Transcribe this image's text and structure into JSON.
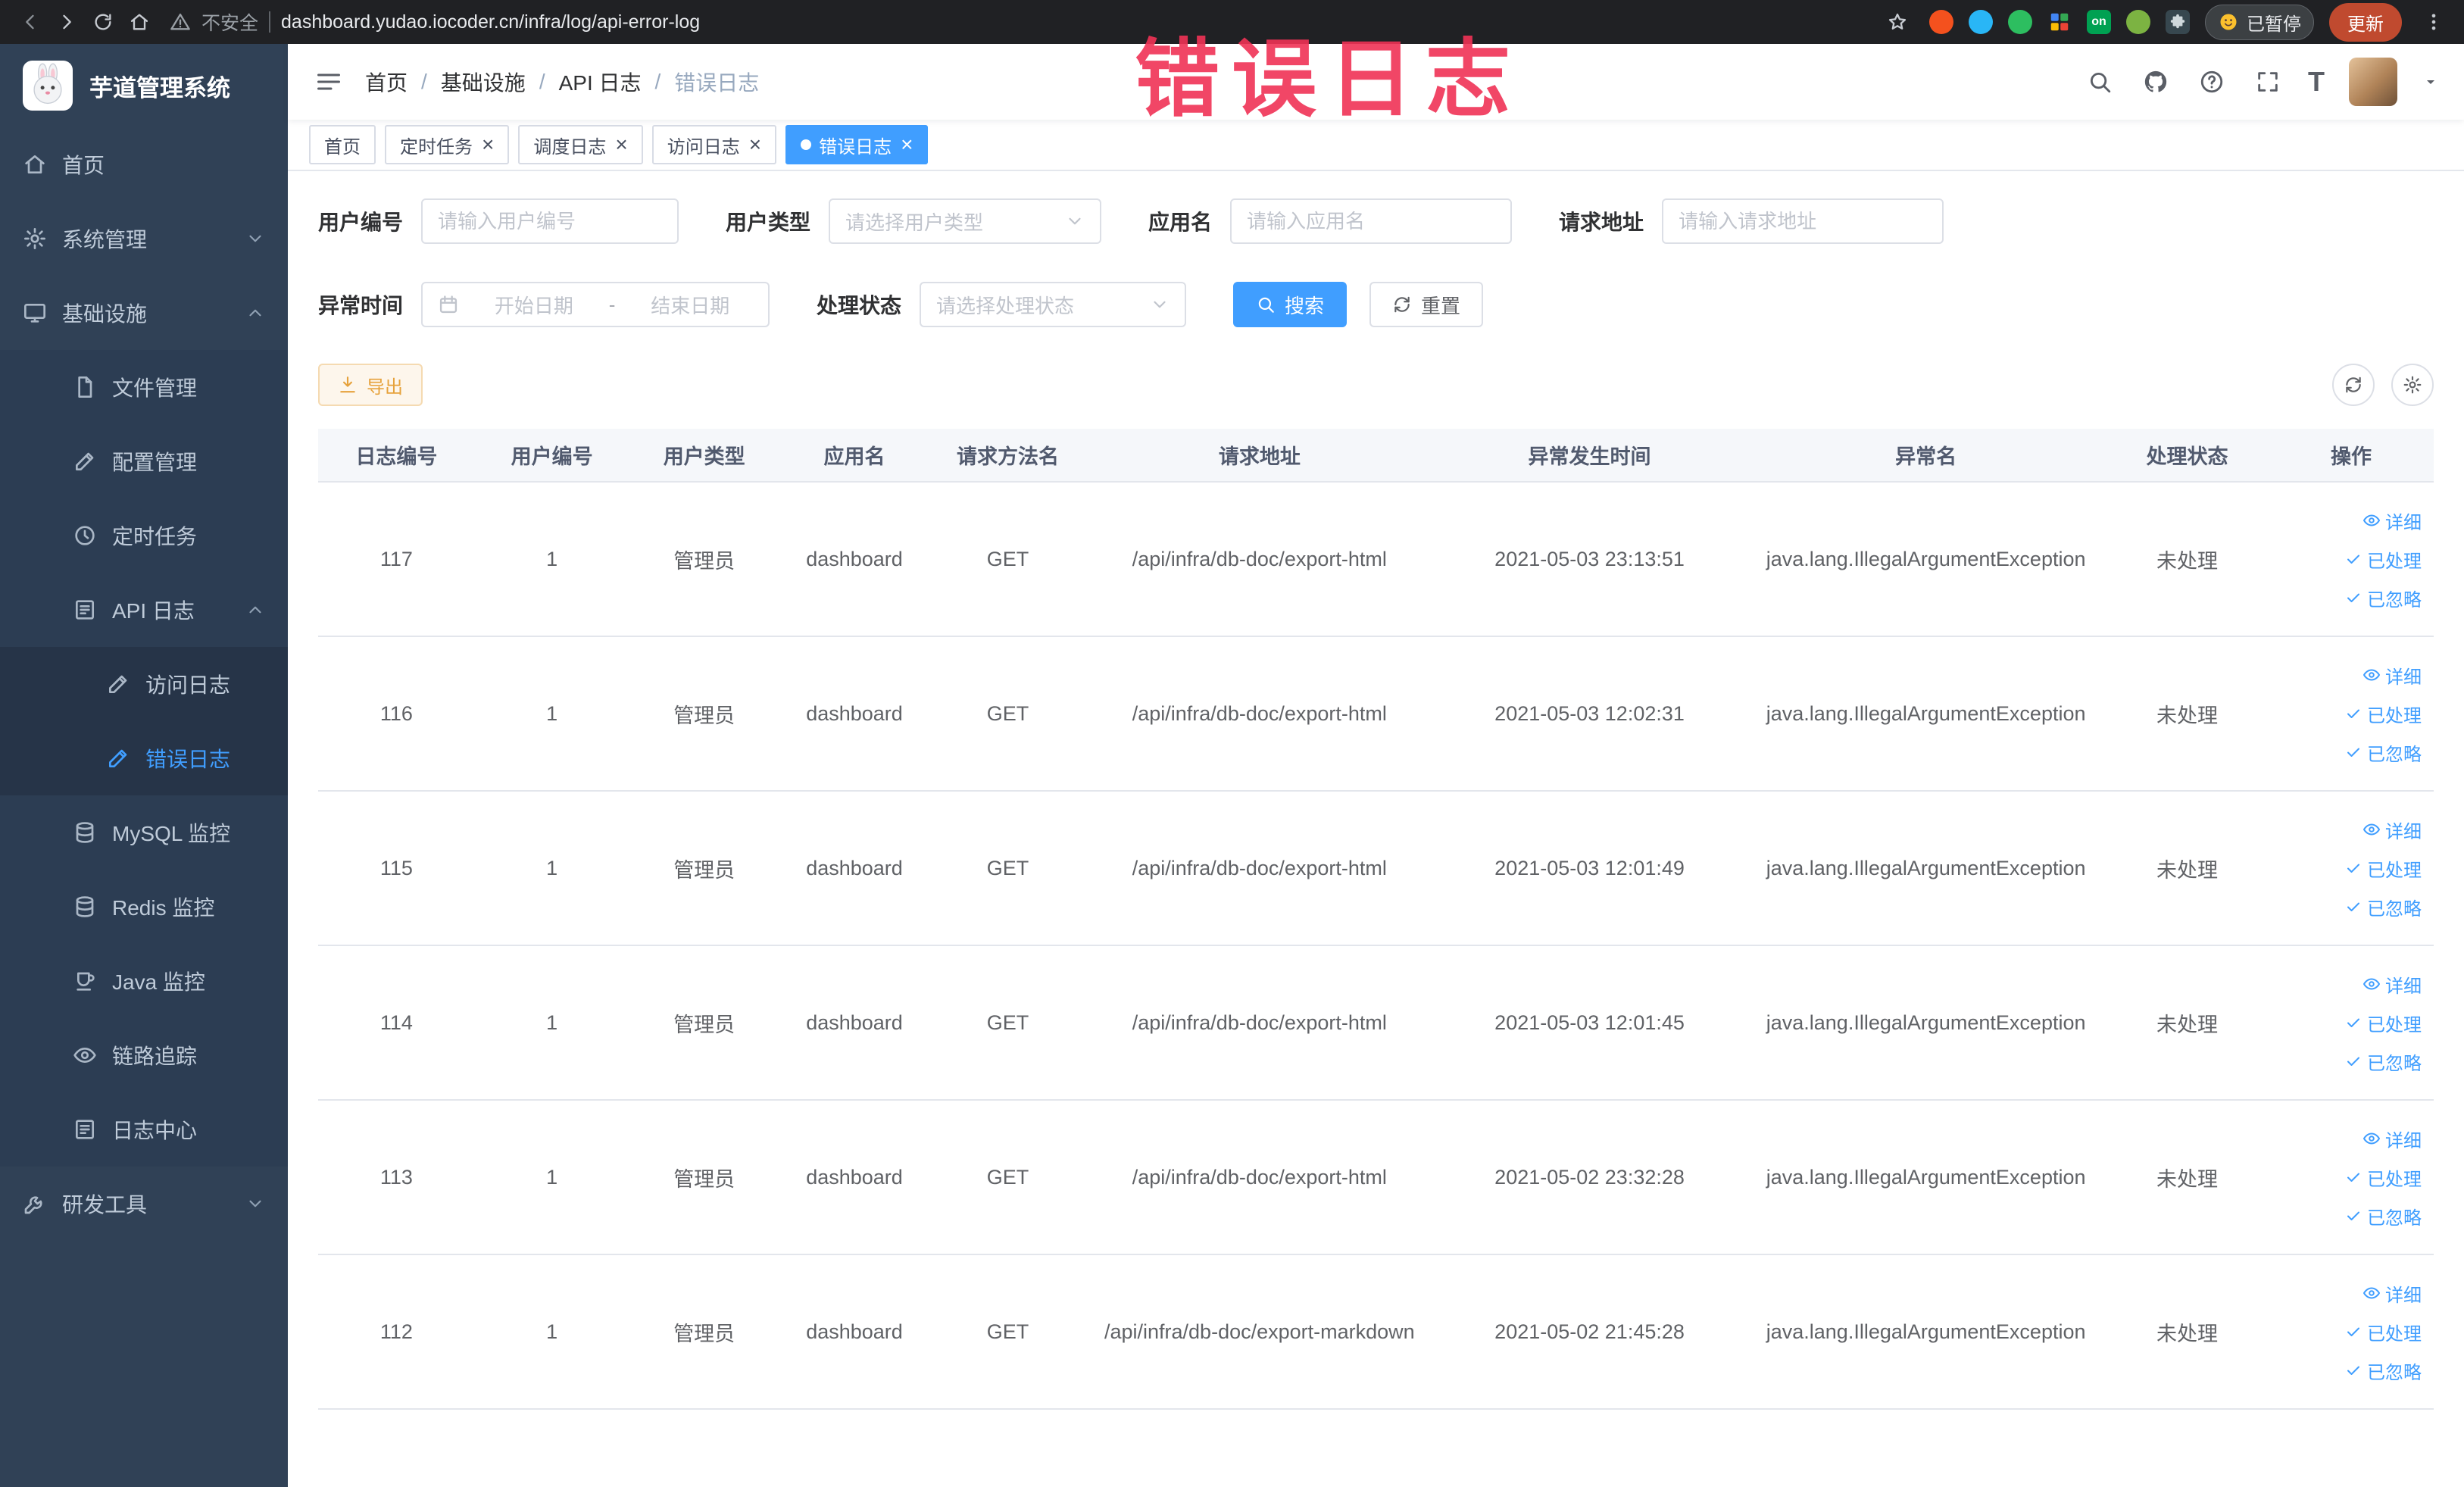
{
  "browser": {
    "security_label": "不安全",
    "url": "dashboard.yudao.iocoder.cn/infra/log/api-error-log",
    "paused_label": "已暂停",
    "update_label": "更新",
    "ext_on_label": "on"
  },
  "watermark": "错误日志",
  "sidebar": {
    "logo_title": "芋道管理系统",
    "items": [
      {
        "key": "home",
        "label": "首页",
        "depth": 0,
        "icon": "home"
      },
      {
        "key": "system",
        "label": "系统管理",
        "depth": 0,
        "icon": "gear",
        "arrow": "down"
      },
      {
        "key": "infra",
        "label": "基础设施",
        "depth": 0,
        "icon": "monitor",
        "arrow": "up"
      },
      {
        "key": "file",
        "label": "文件管理",
        "depth": 1,
        "icon": "file"
      },
      {
        "key": "config",
        "label": "配置管理",
        "depth": 1,
        "icon": "edit"
      },
      {
        "key": "job",
        "label": "定时任务",
        "depth": 1,
        "icon": "clock"
      },
      {
        "key": "api-log",
        "label": "API 日志",
        "depth": 1,
        "icon": "list",
        "arrow": "up"
      },
      {
        "key": "access-log",
        "label": "访问日志",
        "depth": 2,
        "icon": "edit"
      },
      {
        "key": "error-log",
        "label": "错误日志",
        "depth": 2,
        "icon": "edit",
        "active": true
      },
      {
        "key": "mysql",
        "label": "MySQL 监控",
        "depth": 1,
        "icon": "db"
      },
      {
        "key": "redis",
        "label": "Redis 监控",
        "depth": 1,
        "icon": "db"
      },
      {
        "key": "java",
        "label": "Java 监控",
        "depth": 1,
        "icon": "java"
      },
      {
        "key": "trace",
        "label": "链路追踪",
        "depth": 1,
        "icon": "eye"
      },
      {
        "key": "log-center",
        "label": "日志中心",
        "depth": 1,
        "icon": "list"
      },
      {
        "key": "dev-tools",
        "label": "研发工具",
        "depth": 0,
        "icon": "wrench",
        "arrow": "down"
      }
    ]
  },
  "breadcrumb": {
    "separator": "/",
    "items": [
      "首页",
      "基础设施",
      "API 日志",
      "错误日志"
    ]
  },
  "tabs": [
    {
      "key": "home",
      "label": "首页",
      "active": false,
      "closable": false
    },
    {
      "key": "job",
      "label": "定时任务",
      "active": false,
      "closable": true
    },
    {
      "key": "job-log",
      "label": "调度日志",
      "active": false,
      "closable": true
    },
    {
      "key": "access-log",
      "label": "访问日志",
      "active": false,
      "closable": true
    },
    {
      "key": "error-log",
      "label": "错误日志",
      "active": true,
      "closable": true
    }
  ],
  "filters": {
    "user_id": {
      "label": "用户编号",
      "placeholder": "请输入用户编号"
    },
    "user_type": {
      "label": "用户类型",
      "placeholder": "请选择用户类型"
    },
    "app_name": {
      "label": "应用名",
      "placeholder": "请输入应用名"
    },
    "request_url": {
      "label": "请求地址",
      "placeholder": "请输入请求地址"
    },
    "exception_time": {
      "label": "异常时间",
      "start_placeholder": "开始日期",
      "separator": "-",
      "end_placeholder": "结束日期"
    },
    "process_status": {
      "label": "处理状态",
      "placeholder": "请选择处理状态"
    },
    "search_button": "搜索",
    "reset_button": "重置"
  },
  "toolbar": {
    "export_label": "导出"
  },
  "table": {
    "headers": [
      "日志编号",
      "用户编号",
      "用户类型",
      "应用名",
      "请求方法名",
      "请求地址",
      "异常发生时间",
      "异常名",
      "处理状态",
      "操作"
    ],
    "row_actions": [
      {
        "key": "detail",
        "label": "详细",
        "icon": "eye"
      },
      {
        "key": "processed",
        "label": "已处理",
        "icon": "check"
      },
      {
        "key": "ignored",
        "label": "已忽略",
        "icon": "check"
      }
    ],
    "rows": [
      {
        "id": "117",
        "user_id": "1",
        "user_type": "管理员",
        "app": "dashboard",
        "method": "GET",
        "url": "/api/infra/db-doc/export-html",
        "time": "2021-05-03 23:13:51",
        "exception": "java.lang.IllegalArgumentException",
        "status": "未处理"
      },
      {
        "id": "116",
        "user_id": "1",
        "user_type": "管理员",
        "app": "dashboard",
        "method": "GET",
        "url": "/api/infra/db-doc/export-html",
        "time": "2021-05-03 12:02:31",
        "exception": "java.lang.IllegalArgumentException",
        "status": "未处理"
      },
      {
        "id": "115",
        "user_id": "1",
        "user_type": "管理员",
        "app": "dashboard",
        "method": "GET",
        "url": "/api/infra/db-doc/export-html",
        "time": "2021-05-03 12:01:49",
        "exception": "java.lang.IllegalArgumentException",
        "status": "未处理"
      },
      {
        "id": "114",
        "user_id": "1",
        "user_type": "管理员",
        "app": "dashboard",
        "method": "GET",
        "url": "/api/infra/db-doc/export-html",
        "time": "2021-05-03 12:01:45",
        "exception": "java.lang.IllegalArgumentException",
        "status": "未处理"
      },
      {
        "id": "113",
        "user_id": "1",
        "user_type": "管理员",
        "app": "dashboard",
        "method": "GET",
        "url": "/api/infra/db-doc/export-html",
        "time": "2021-05-02 23:32:28",
        "exception": "java.lang.IllegalArgumentException",
        "status": "未处理"
      },
      {
        "id": "112",
        "user_id": "1",
        "user_type": "管理员",
        "app": "dashboard",
        "method": "GET",
        "url": "/api/infra/db-doc/export-markdown",
        "time": "2021-05-02 21:45:28",
        "exception": "java.lang.IllegalArgumentException",
        "status": "未处理"
      }
    ]
  }
}
